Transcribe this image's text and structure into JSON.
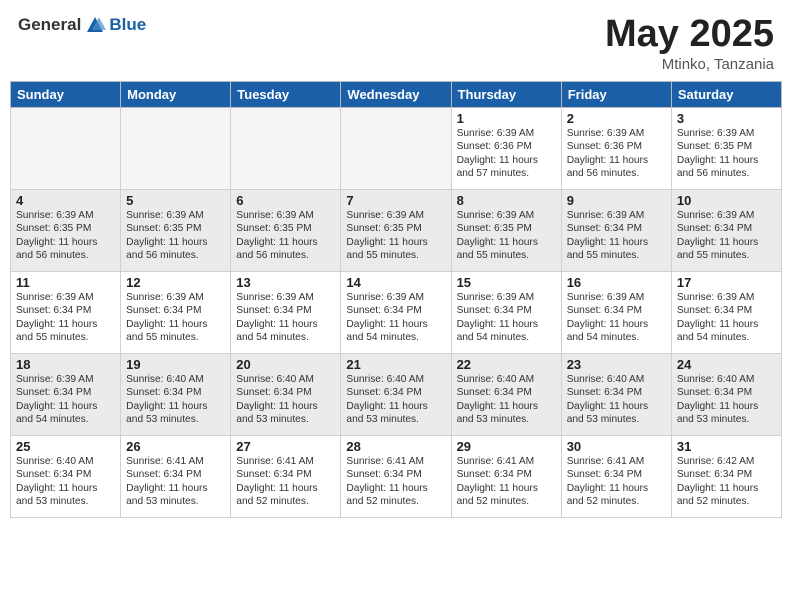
{
  "header": {
    "logo_general": "General",
    "logo_blue": "Blue",
    "title": "May 2025",
    "location": "Mtinko, Tanzania"
  },
  "days": [
    "Sunday",
    "Monday",
    "Tuesday",
    "Wednesday",
    "Thursday",
    "Friday",
    "Saturday"
  ],
  "weeks": [
    [
      {
        "day": "",
        "empty": true
      },
      {
        "day": "",
        "empty": true
      },
      {
        "day": "",
        "empty": true
      },
      {
        "day": "",
        "empty": true
      },
      {
        "day": "1",
        "line1": "Sunrise: 6:39 AM",
        "line2": "Sunset: 6:36 PM",
        "line3": "Daylight: 11 hours",
        "line4": "and 57 minutes."
      },
      {
        "day": "2",
        "line1": "Sunrise: 6:39 AM",
        "line2": "Sunset: 6:36 PM",
        "line3": "Daylight: 11 hours",
        "line4": "and 56 minutes."
      },
      {
        "day": "3",
        "line1": "Sunrise: 6:39 AM",
        "line2": "Sunset: 6:35 PM",
        "line3": "Daylight: 11 hours",
        "line4": "and 56 minutes."
      }
    ],
    [
      {
        "day": "4",
        "line1": "Sunrise: 6:39 AM",
        "line2": "Sunset: 6:35 PM",
        "line3": "Daylight: 11 hours",
        "line4": "and 56 minutes."
      },
      {
        "day": "5",
        "line1": "Sunrise: 6:39 AM",
        "line2": "Sunset: 6:35 PM",
        "line3": "Daylight: 11 hours",
        "line4": "and 56 minutes."
      },
      {
        "day": "6",
        "line1": "Sunrise: 6:39 AM",
        "line2": "Sunset: 6:35 PM",
        "line3": "Daylight: 11 hours",
        "line4": "and 56 minutes."
      },
      {
        "day": "7",
        "line1": "Sunrise: 6:39 AM",
        "line2": "Sunset: 6:35 PM",
        "line3": "Daylight: 11 hours",
        "line4": "and 55 minutes."
      },
      {
        "day": "8",
        "line1": "Sunrise: 6:39 AM",
        "line2": "Sunset: 6:35 PM",
        "line3": "Daylight: 11 hours",
        "line4": "and 55 minutes."
      },
      {
        "day": "9",
        "line1": "Sunrise: 6:39 AM",
        "line2": "Sunset: 6:34 PM",
        "line3": "Daylight: 11 hours",
        "line4": "and 55 minutes."
      },
      {
        "day": "10",
        "line1": "Sunrise: 6:39 AM",
        "line2": "Sunset: 6:34 PM",
        "line3": "Daylight: 11 hours",
        "line4": "and 55 minutes."
      }
    ],
    [
      {
        "day": "11",
        "line1": "Sunrise: 6:39 AM",
        "line2": "Sunset: 6:34 PM",
        "line3": "Daylight: 11 hours",
        "line4": "and 55 minutes."
      },
      {
        "day": "12",
        "line1": "Sunrise: 6:39 AM",
        "line2": "Sunset: 6:34 PM",
        "line3": "Daylight: 11 hours",
        "line4": "and 55 minutes."
      },
      {
        "day": "13",
        "line1": "Sunrise: 6:39 AM",
        "line2": "Sunset: 6:34 PM",
        "line3": "Daylight: 11 hours",
        "line4": "and 54 minutes."
      },
      {
        "day": "14",
        "line1": "Sunrise: 6:39 AM",
        "line2": "Sunset: 6:34 PM",
        "line3": "Daylight: 11 hours",
        "line4": "and 54 minutes."
      },
      {
        "day": "15",
        "line1": "Sunrise: 6:39 AM",
        "line2": "Sunset: 6:34 PM",
        "line3": "Daylight: 11 hours",
        "line4": "and 54 minutes."
      },
      {
        "day": "16",
        "line1": "Sunrise: 6:39 AM",
        "line2": "Sunset: 6:34 PM",
        "line3": "Daylight: 11 hours",
        "line4": "and 54 minutes."
      },
      {
        "day": "17",
        "line1": "Sunrise: 6:39 AM",
        "line2": "Sunset: 6:34 PM",
        "line3": "Daylight: 11 hours",
        "line4": "and 54 minutes."
      }
    ],
    [
      {
        "day": "18",
        "line1": "Sunrise: 6:39 AM",
        "line2": "Sunset: 6:34 PM",
        "line3": "Daylight: 11 hours",
        "line4": "and 54 minutes."
      },
      {
        "day": "19",
        "line1": "Sunrise: 6:40 AM",
        "line2": "Sunset: 6:34 PM",
        "line3": "Daylight: 11 hours",
        "line4": "and 53 minutes."
      },
      {
        "day": "20",
        "line1": "Sunrise: 6:40 AM",
        "line2": "Sunset: 6:34 PM",
        "line3": "Daylight: 11 hours",
        "line4": "and 53 minutes."
      },
      {
        "day": "21",
        "line1": "Sunrise: 6:40 AM",
        "line2": "Sunset: 6:34 PM",
        "line3": "Daylight: 11 hours",
        "line4": "and 53 minutes."
      },
      {
        "day": "22",
        "line1": "Sunrise: 6:40 AM",
        "line2": "Sunset: 6:34 PM",
        "line3": "Daylight: 11 hours",
        "line4": "and 53 minutes."
      },
      {
        "day": "23",
        "line1": "Sunrise: 6:40 AM",
        "line2": "Sunset: 6:34 PM",
        "line3": "Daylight: 11 hours",
        "line4": "and 53 minutes."
      },
      {
        "day": "24",
        "line1": "Sunrise: 6:40 AM",
        "line2": "Sunset: 6:34 PM",
        "line3": "Daylight: 11 hours",
        "line4": "and 53 minutes."
      }
    ],
    [
      {
        "day": "25",
        "line1": "Sunrise: 6:40 AM",
        "line2": "Sunset: 6:34 PM",
        "line3": "Daylight: 11 hours",
        "line4": "and 53 minutes."
      },
      {
        "day": "26",
        "line1": "Sunrise: 6:41 AM",
        "line2": "Sunset: 6:34 PM",
        "line3": "Daylight: 11 hours",
        "line4": "and 53 minutes."
      },
      {
        "day": "27",
        "line1": "Sunrise: 6:41 AM",
        "line2": "Sunset: 6:34 PM",
        "line3": "Daylight: 11 hours",
        "line4": "and 52 minutes."
      },
      {
        "day": "28",
        "line1": "Sunrise: 6:41 AM",
        "line2": "Sunset: 6:34 PM",
        "line3": "Daylight: 11 hours",
        "line4": "and 52 minutes."
      },
      {
        "day": "29",
        "line1": "Sunrise: 6:41 AM",
        "line2": "Sunset: 6:34 PM",
        "line3": "Daylight: 11 hours",
        "line4": "and 52 minutes."
      },
      {
        "day": "30",
        "line1": "Sunrise: 6:41 AM",
        "line2": "Sunset: 6:34 PM",
        "line3": "Daylight: 11 hours",
        "line4": "and 52 minutes."
      },
      {
        "day": "31",
        "line1": "Sunrise: 6:42 AM",
        "line2": "Sunset: 6:34 PM",
        "line3": "Daylight: 11 hours",
        "line4": "and 52 minutes."
      }
    ]
  ]
}
